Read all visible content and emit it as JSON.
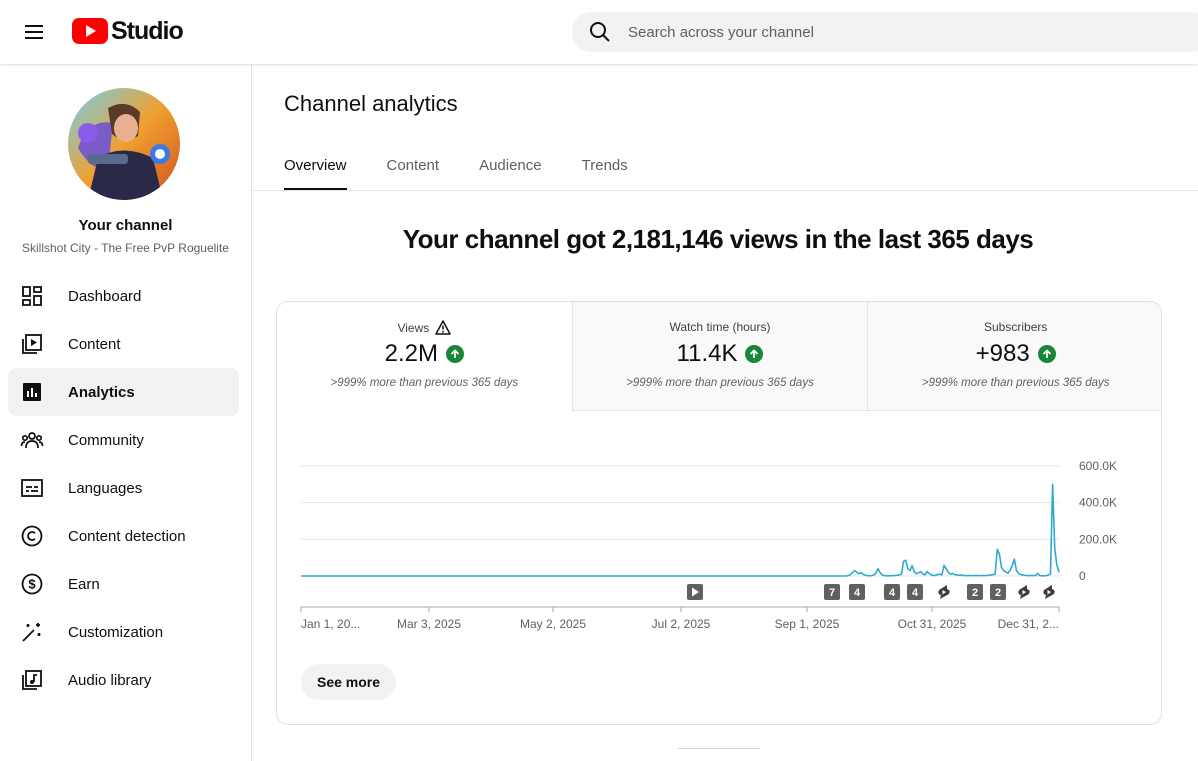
{
  "header": {
    "logo_text": "Studio",
    "search_placeholder": "Search across your channel"
  },
  "sidebar": {
    "channel_title": "Your channel",
    "channel_name": "Skillshot City - The Free PvP Roguelite",
    "items": [
      {
        "label": "Dashboard",
        "icon": "dashboard-icon"
      },
      {
        "label": "Content",
        "icon": "content-icon"
      },
      {
        "label": "Analytics",
        "icon": "analytics-icon",
        "active": true
      },
      {
        "label": "Community",
        "icon": "community-icon"
      },
      {
        "label": "Languages",
        "icon": "languages-icon"
      },
      {
        "label": "Content detection",
        "icon": "copyright-icon"
      },
      {
        "label": "Earn",
        "icon": "earn-icon"
      },
      {
        "label": "Customization",
        "icon": "magic-wand-icon"
      },
      {
        "label": "Audio library",
        "icon": "audio-library-icon"
      }
    ]
  },
  "main": {
    "title": "Channel analytics",
    "tabs": [
      {
        "label": "Overview",
        "active": true
      },
      {
        "label": "Content"
      },
      {
        "label": "Audience"
      },
      {
        "label": "Trends"
      }
    ],
    "headline": "Your channel got 2,181,146 views in the last 365 days",
    "metrics": [
      {
        "label": "Views",
        "value": "2.2M",
        "comparison": ">999% more than previous 365 days",
        "warning": true
      },
      {
        "label": "Watch time (hours)",
        "value": "11.4K",
        "comparison": ">999% more than previous 365 days"
      },
      {
        "label": "Subscribers",
        "value": "+983",
        "comparison": ">999% more than previous 365 days"
      }
    ],
    "see_more": "See more"
  },
  "colors": {
    "accent_red": "#ff0000",
    "line": "#2eaad1",
    "positive": "#198639"
  },
  "chart_data": {
    "type": "line",
    "ylabel_ticks": [
      "600.0K",
      "400.0K",
      "200.0K",
      "0"
    ],
    "ylim": [
      0,
      600000
    ],
    "x_ticks": [
      "Jan 1, 20...",
      "Mar 3, 2025",
      "May 2, 2025",
      "Jul 2, 2025",
      "Sep 1, 2025",
      "Oct 31, 2025",
      "Dec 31, 2..."
    ],
    "series": [
      {
        "values": [
          0,
          0,
          0,
          0,
          0,
          0,
          0,
          0,
          0,
          0,
          0,
          0,
          0,
          0,
          0,
          0,
          0,
          0,
          0,
          0,
          0,
          0,
          0,
          0,
          0,
          0,
          0,
          0,
          0,
          0,
          0,
          0,
          0,
          0,
          0,
          0,
          0,
          0,
          0,
          0,
          0,
          0,
          0,
          0,
          0,
          0,
          0,
          0,
          0,
          0,
          0,
          0,
          0,
          0,
          0,
          0,
          0,
          0,
          0,
          0,
          0,
          0,
          0,
          0,
          0,
          0,
          0,
          0,
          0,
          0,
          0,
          0,
          0,
          0,
          0,
          0,
          0,
          0,
          0,
          0,
          0,
          0,
          0,
          0,
          0,
          0,
          0,
          0,
          0,
          0,
          0,
          0,
          0,
          0,
          0,
          0,
          0,
          0,
          0,
          0,
          0,
          0,
          0,
          0,
          0,
          0,
          0,
          0,
          0,
          0,
          0,
          0,
          0,
          0,
          0,
          0,
          0,
          0,
          0,
          0,
          0,
          0,
          0,
          0,
          0,
          0,
          0,
          0,
          0,
          0,
          0,
          0,
          0,
          0,
          0,
          0,
          0,
          0,
          0,
          0,
          0,
          0,
          0,
          0,
          0,
          0,
          0,
          0,
          0,
          0,
          0,
          0,
          0,
          0,
          0,
          0,
          0,
          0,
          0,
          0,
          0,
          0,
          0,
          0,
          0,
          0,
          0,
          0,
          0,
          0,
          0,
          0,
          0,
          0,
          0,
          0,
          0,
          0,
          0,
          0,
          0,
          0,
          0,
          0,
          0,
          0,
          0,
          0,
          0,
          0,
          0,
          0,
          0,
          0,
          0,
          0,
          0,
          0,
          0,
          0,
          0,
          0,
          0,
          0,
          0,
          0,
          0,
          0,
          0,
          0,
          0,
          0,
          0,
          0,
          0,
          0,
          0,
          0,
          0,
          0,
          0,
          0,
          0,
          0,
          0,
          0,
          0,
          0,
          0,
          0,
          0,
          0,
          0,
          0,
          0,
          0,
          0,
          0,
          0,
          0,
          0,
          0,
          0,
          0,
          0,
          0,
          0,
          0,
          0,
          0,
          0,
          0,
          0,
          0,
          0,
          0,
          0,
          2000,
          8000,
          18000,
          30000,
          22000,
          12000,
          18000,
          10000,
          4000,
          2000,
          1000,
          2000,
          6000,
          14000,
          40000,
          18000,
          6000,
          2000,
          1000,
          1000,
          1500,
          2000,
          3000,
          4000,
          6000,
          10000,
          80000,
          86000,
          40000,
          30000,
          56000,
          24000,
          12000,
          18000,
          24000,
          12000,
          6000,
          24000,
          14000,
          6000,
          4000,
          3000,
          8000,
          10000,
          6000,
          58000,
          40000,
          20000,
          10000,
          14000,
          8000,
          6000,
          4000,
          6000,
          3000,
          2000,
          2000,
          3000,
          2000,
          2000,
          3000,
          2000,
          2000,
          3000,
          2000,
          3000,
          4000,
          6000,
          8000,
          10000,
          145000,
          120000,
          48000,
          30000,
          22000,
          16000,
          30000,
          56000,
          92000,
          30000,
          14000,
          8000,
          6000,
          4000,
          2000,
          2000,
          3000,
          2000,
          3000,
          14000,
          2000,
          1000,
          1000,
          2000,
          6000,
          10000,
          500000,
          150000,
          60000,
          20000
        ]
      }
    ],
    "markers": [
      "play",
      "7",
      "4",
      "4",
      "4",
      "shorts",
      "2",
      "2",
      "shorts",
      "shorts"
    ],
    "grid": true
  }
}
